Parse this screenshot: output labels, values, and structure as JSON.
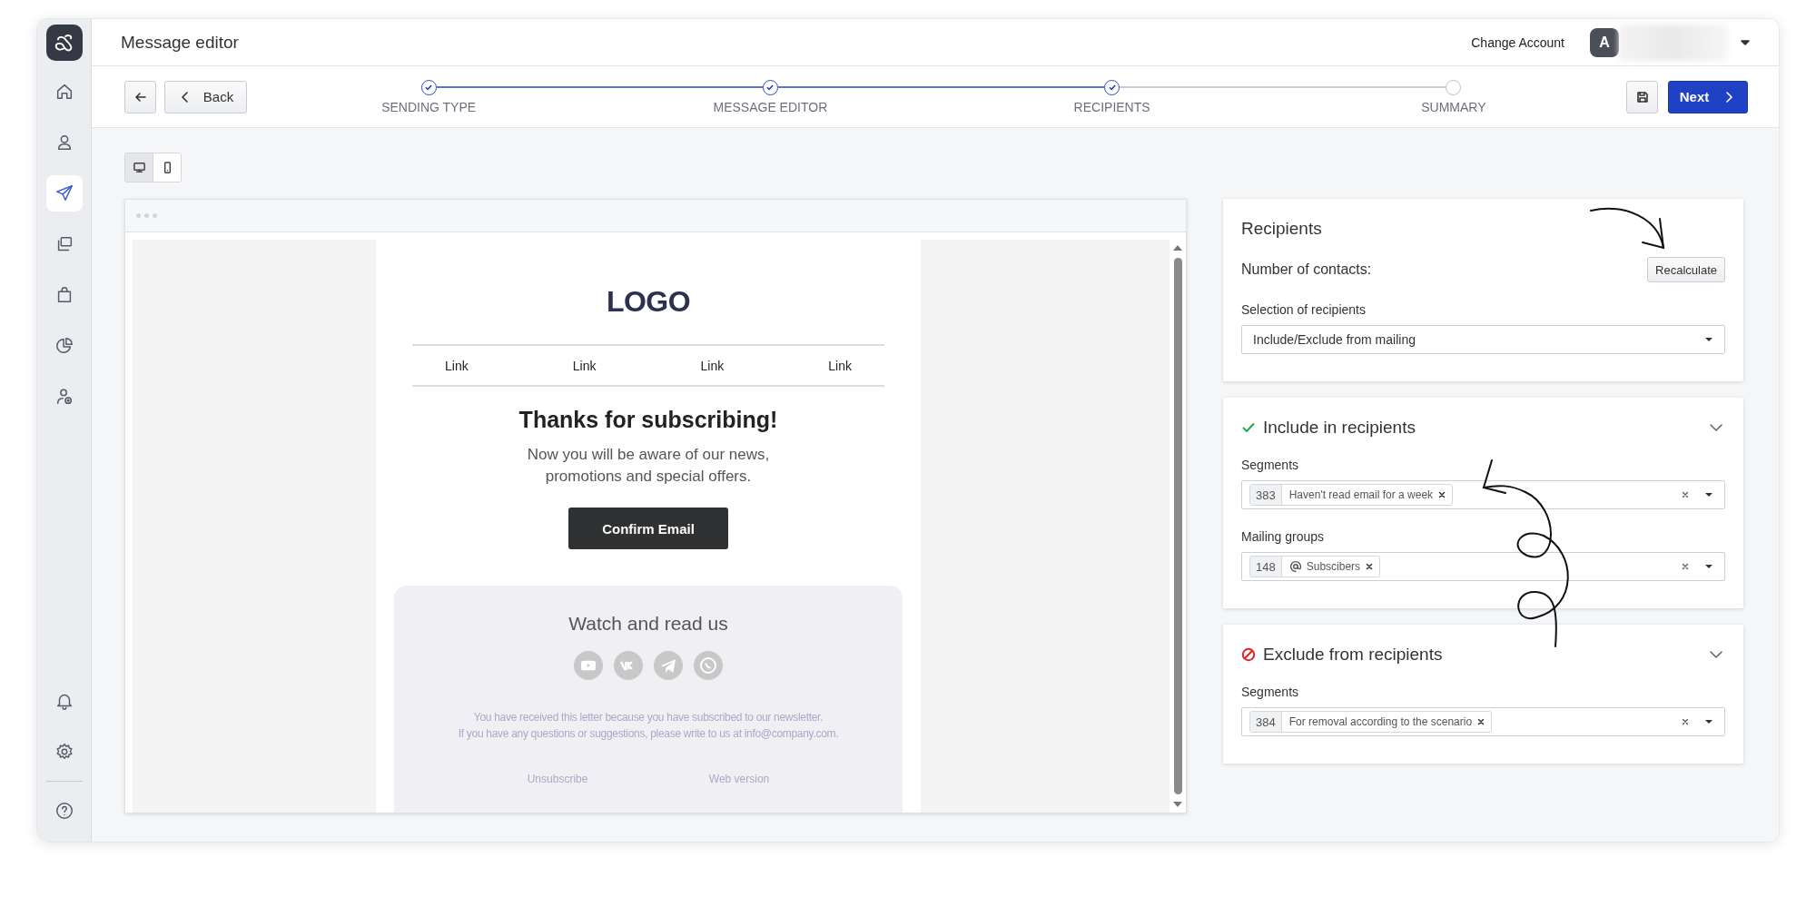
{
  "sidebar": {
    "items": [
      {
        "selected": false
      },
      {
        "selected": false
      },
      {
        "selected": true
      },
      {
        "selected": false
      },
      {
        "selected": false
      },
      {
        "selected": false
      },
      {
        "selected": false
      }
    ],
    "bottom_items": [
      {
        "selected": false
      },
      {
        "selected": false
      },
      {
        "selected": false
      }
    ]
  },
  "header": {
    "title": "Message editor",
    "change_account": "Change Account",
    "avatar_letter": "A"
  },
  "wizard": {
    "back_label": "Back",
    "next_label": "Next",
    "steps": [
      {
        "label": "SENDING TYPE",
        "completed": true
      },
      {
        "label": "MESSAGE EDITOR",
        "completed": true
      },
      {
        "label": "RECIPIENTS",
        "completed": true
      },
      {
        "label": "SUMMARY",
        "completed": false
      }
    ]
  },
  "view_toggle": [
    {
      "selected": true
    },
    {
      "selected": false
    }
  ],
  "email_preview": {
    "logo": "LOGO",
    "links": [
      "Link",
      "Link",
      "Link",
      "Link"
    ],
    "heading": "Thanks for subscribing!",
    "text_lines": [
      "Now you will be aware of our news,",
      "promotions and special offers."
    ],
    "button": "Confirm Email",
    "footer": {
      "title": "Watch and read us",
      "notice_lines": [
        "You have received this letter because you have subscribed to our newsletter.",
        "If you have any questions or suggestions, please write to us at info@company.com."
      ],
      "links": [
        "Unsubscribe",
        "Web version"
      ]
    }
  },
  "recipients": {
    "title": "Recipients",
    "contacts_label": "Number of contacts:",
    "recalculate": "Recalculate",
    "selection_label": "Selection of recipients",
    "selection_value": "Include/Exclude from mailing"
  },
  "sections": [
    {
      "kind": "include",
      "title": "Include in recipients",
      "fields": [
        {
          "label": "Segments",
          "tags": [
            {
              "kind": "segment",
              "count": "383",
              "label": "Haven't read email for a week"
            }
          ]
        },
        {
          "label": "Mailing groups",
          "tags": [
            {
              "kind": "group",
              "count": "148",
              "label": "Subscibers"
            }
          ]
        }
      ]
    },
    {
      "kind": "exclude",
      "title": "Exclude from recipients",
      "fields": [
        {
          "label": "Segments",
          "tags": [
            {
              "kind": "segment",
              "count": "384",
              "label": "For removal according to the scenario"
            }
          ]
        }
      ]
    }
  ]
}
